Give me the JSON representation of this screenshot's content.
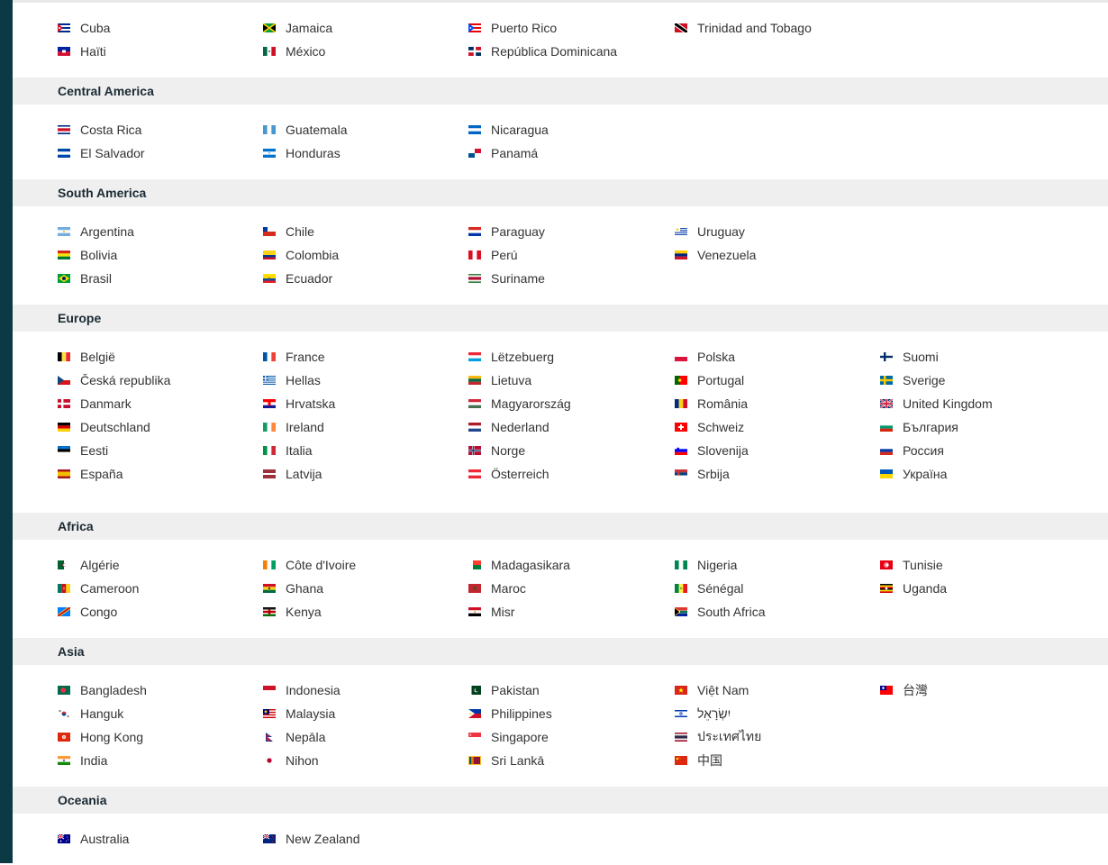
{
  "regions": [
    {
      "key": "caribbean",
      "title": "",
      "top_pad": 15,
      "bottom_pad": 16,
      "rows": 2,
      "countries": [
        {
          "name": "Cuba",
          "flag": "cu"
        },
        {
          "name": "Haïti",
          "flag": "ht"
        },
        {
          "name": "Jamaica",
          "flag": "jm"
        },
        {
          "name": "México",
          "flag": "mx"
        },
        {
          "name": "Puerto Rico",
          "flag": "pr"
        },
        {
          "name": "República Dominicana",
          "flag": "do"
        },
        {
          "name": "Trinidad and Tobago",
          "flag": "tt"
        }
      ]
    },
    {
      "key": "central-america",
      "title": "Central America",
      "top_pad": 15,
      "bottom_pad": 16,
      "rows": 2,
      "countries": [
        {
          "name": "Costa Rica",
          "flag": "cr"
        },
        {
          "name": "El Salvador",
          "flag": "sv"
        },
        {
          "name": "Guatemala",
          "flag": "gt"
        },
        {
          "name": "Honduras",
          "flag": "hn"
        },
        {
          "name": "Nicaragua",
          "flag": "ni"
        },
        {
          "name": "Panamá",
          "flag": "pa"
        }
      ]
    },
    {
      "key": "south-america",
      "title": "South America",
      "top_pad": 15,
      "bottom_pad": 16,
      "rows": 3,
      "countries": [
        {
          "name": "Argentina",
          "flag": "ar"
        },
        {
          "name": "Bolivia",
          "flag": "bo"
        },
        {
          "name": "Brasil",
          "flag": "br"
        },
        {
          "name": "Chile",
          "flag": "cl"
        },
        {
          "name": "Colombia",
          "flag": "co"
        },
        {
          "name": "Ecuador",
          "flag": "ec"
        },
        {
          "name": "Paraguay",
          "flag": "py"
        },
        {
          "name": "Perú",
          "flag": "pe"
        },
        {
          "name": "Suriname",
          "flag": "sr"
        },
        {
          "name": "Uruguay",
          "flag": "uy"
        },
        {
          "name": "Venezuela",
          "flag": "ve"
        }
      ]
    },
    {
      "key": "europe",
      "title": "Europe",
      "top_pad": 15,
      "bottom_pad": 30,
      "rows": 6,
      "countries": [
        {
          "name": "België",
          "flag": "be"
        },
        {
          "name": "Česká republika",
          "flag": "cz"
        },
        {
          "name": "Danmark",
          "flag": "dk"
        },
        {
          "name": "Deutschland",
          "flag": "de"
        },
        {
          "name": "Eesti",
          "flag": "ee"
        },
        {
          "name": "España",
          "flag": "es"
        },
        {
          "name": "France",
          "flag": "fr"
        },
        {
          "name": "Hellas",
          "flag": "gr"
        },
        {
          "name": "Hrvatska",
          "flag": "hr"
        },
        {
          "name": "Ireland",
          "flag": "ie"
        },
        {
          "name": "Italia",
          "flag": "it"
        },
        {
          "name": "Latvija",
          "flag": "lv"
        },
        {
          "name": "Lëtzebuerg",
          "flag": "lu"
        },
        {
          "name": "Lietuva",
          "flag": "lt"
        },
        {
          "name": "Magyarország",
          "flag": "hu"
        },
        {
          "name": "Nederland",
          "flag": "nl"
        },
        {
          "name": "Norge",
          "flag": "no"
        },
        {
          "name": "Österreich",
          "flag": "at"
        },
        {
          "name": "Polska",
          "flag": "pl"
        },
        {
          "name": "Portugal",
          "flag": "pt"
        },
        {
          "name": "România",
          "flag": "ro"
        },
        {
          "name": "Schweiz",
          "flag": "ch"
        },
        {
          "name": "Slovenija",
          "flag": "si"
        },
        {
          "name": "Srbija",
          "flag": "rs"
        },
        {
          "name": "Suomi",
          "flag": "fi"
        },
        {
          "name": "Sverige",
          "flag": "se"
        },
        {
          "name": "United Kingdom",
          "flag": "gb"
        },
        {
          "name": "България",
          "flag": "bg"
        },
        {
          "name": "Россия",
          "flag": "ru"
        },
        {
          "name": "Україна",
          "flag": "ua"
        }
      ]
    },
    {
      "key": "africa",
      "title": "Africa",
      "top_pad": 15,
      "bottom_pad": 16,
      "rows": 3,
      "countries": [
        {
          "name": "Algérie",
          "flag": "dz"
        },
        {
          "name": "Cameroon",
          "flag": "cm"
        },
        {
          "name": "Congo",
          "flag": "cd"
        },
        {
          "name": "Côte d'Ivoire",
          "flag": "ci"
        },
        {
          "name": "Ghana",
          "flag": "gh"
        },
        {
          "name": "Kenya",
          "flag": "ke"
        },
        {
          "name": "Madagasikara",
          "flag": "mg"
        },
        {
          "name": "Maroc",
          "flag": "ma"
        },
        {
          "name": "Misr",
          "flag": "eg"
        },
        {
          "name": "Nigeria",
          "flag": "ng"
        },
        {
          "name": "Sénégal",
          "flag": "sn"
        },
        {
          "name": "South Africa",
          "flag": "za"
        },
        {
          "name": "Tunisie",
          "flag": "tn"
        },
        {
          "name": "Uganda",
          "flag": "ug"
        }
      ]
    },
    {
      "key": "asia",
      "title": "Asia",
      "top_pad": 15,
      "bottom_pad": 16,
      "rows": 4,
      "countries": [
        {
          "name": "Bangladesh",
          "flag": "bd"
        },
        {
          "name": "Hanguk",
          "flag": "kr"
        },
        {
          "name": "Hong Kong",
          "flag": "hk"
        },
        {
          "name": "India",
          "flag": "in"
        },
        {
          "name": "Indonesia",
          "flag": "id"
        },
        {
          "name": "Malaysia",
          "flag": "my"
        },
        {
          "name": "Nepāla",
          "flag": "np"
        },
        {
          "name": "Nihon",
          "flag": "jp"
        },
        {
          "name": "Pakistan",
          "flag": "pk"
        },
        {
          "name": "Philippines",
          "flag": "ph"
        },
        {
          "name": "Singapore",
          "flag": "sg"
        },
        {
          "name": "Sri Lankā",
          "flag": "lk"
        },
        {
          "name": "Việt Nam",
          "flag": "vn"
        },
        {
          "name": "יִשְׂרָאֵל",
          "flag": "il"
        },
        {
          "name": "ประเทศไทย",
          "flag": "th"
        },
        {
          "name": "中国",
          "flag": "cn"
        },
        {
          "name": "台灣",
          "flag": "tw"
        }
      ]
    },
    {
      "key": "oceania",
      "title": "Oceania",
      "top_pad": 15,
      "bottom_pad": 16,
      "rows": 1,
      "countries": [
        {
          "name": "Australia",
          "flag": "au"
        },
        {
          "name": "New Zealand",
          "flag": "nz"
        }
      ]
    }
  ]
}
